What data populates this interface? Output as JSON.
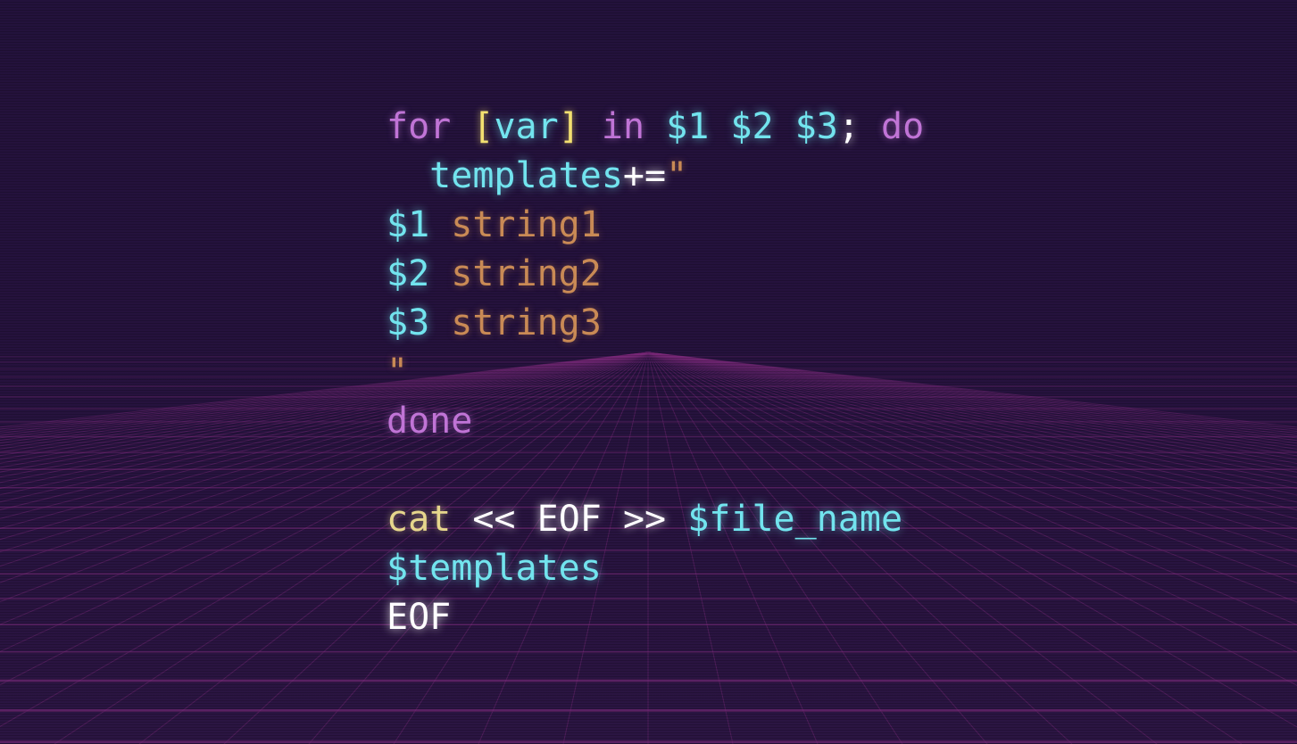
{
  "colors": {
    "background": "#25123d",
    "keyword": "#c074d6",
    "variable": "#72e4ee",
    "bracket": "#f3e070",
    "string": "#c98a55",
    "operator": "#ffffff",
    "command": "#e6d68c",
    "grid": "#7a2a7a"
  },
  "code": {
    "lines": [
      [
        {
          "t": "for",
          "c": "kw"
        },
        {
          "t": " ",
          "c": "sp"
        },
        {
          "t": "[",
          "c": "br"
        },
        {
          "t": "var",
          "c": "var"
        },
        {
          "t": "]",
          "c": "br"
        },
        {
          "t": " ",
          "c": "sp"
        },
        {
          "t": "in",
          "c": "kw"
        },
        {
          "t": " ",
          "c": "sp"
        },
        {
          "t": "$1",
          "c": "var"
        },
        {
          "t": " ",
          "c": "sp"
        },
        {
          "t": "$2",
          "c": "var"
        },
        {
          "t": " ",
          "c": "sp"
        },
        {
          "t": "$3",
          "c": "var"
        },
        {
          "t": ";",
          "c": "op"
        },
        {
          "t": " ",
          "c": "sp"
        },
        {
          "t": "do",
          "c": "kw"
        }
      ],
      [
        {
          "t": "  ",
          "c": "sp"
        },
        {
          "t": "templates",
          "c": "var"
        },
        {
          "t": "+=",
          "c": "op"
        },
        {
          "t": "\"",
          "c": "str"
        }
      ],
      [
        {
          "t": "$1",
          "c": "var"
        },
        {
          "t": " ",
          "c": "sp"
        },
        {
          "t": "string1",
          "c": "str"
        }
      ],
      [
        {
          "t": "$2",
          "c": "var"
        },
        {
          "t": " ",
          "c": "sp"
        },
        {
          "t": "string2",
          "c": "str"
        }
      ],
      [
        {
          "t": "$3",
          "c": "var"
        },
        {
          "t": " ",
          "c": "sp"
        },
        {
          "t": "string3",
          "c": "str"
        }
      ],
      [
        {
          "t": "\"",
          "c": "str"
        }
      ],
      [
        {
          "t": "done",
          "c": "kw"
        }
      ],
      [],
      [
        {
          "t": "cat",
          "c": "cmd"
        },
        {
          "t": " ",
          "c": "sp"
        },
        {
          "t": "<<",
          "c": "op"
        },
        {
          "t": " ",
          "c": "sp"
        },
        {
          "t": "EOF",
          "c": "op"
        },
        {
          "t": " ",
          "c": "sp"
        },
        {
          "t": ">>",
          "c": "op"
        },
        {
          "t": " ",
          "c": "sp"
        },
        {
          "t": "$file_name",
          "c": "var"
        }
      ],
      [
        {
          "t": "$templates",
          "c": "var"
        }
      ],
      [
        {
          "t": "EOF",
          "c": "op"
        }
      ]
    ]
  }
}
